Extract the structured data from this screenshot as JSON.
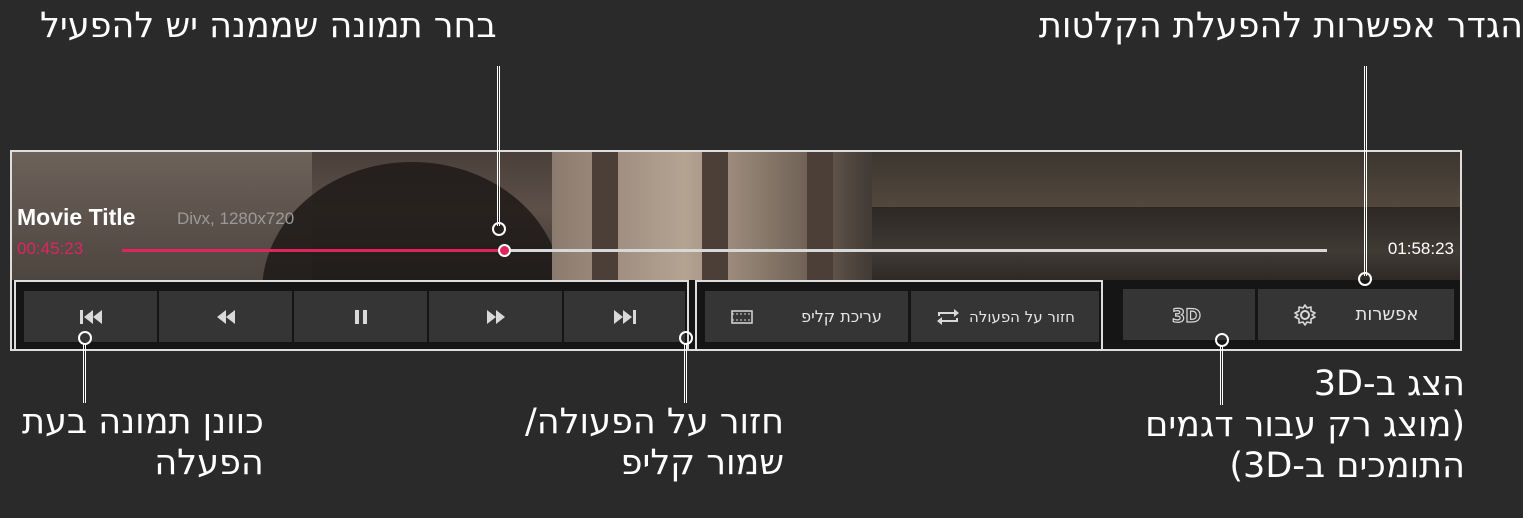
{
  "callouts": {
    "select_picture": "בחר תמונה שממנה יש להפעיל",
    "set_options": "הגדר אפשרות להפעלת הקלטות",
    "adjust_picture_line1": "כוונן תמונה בעת",
    "adjust_picture_line2": "הפעלה",
    "repeat_save_line1": "חזור על הפעולה/",
    "repeat_save_line2": "שמור קליפ",
    "view_3d_line1": "הצג ב-3D",
    "view_3d_line2": "(מוצג רק עבור דגמים",
    "view_3d_line3": "התומכים ב-3D)"
  },
  "player": {
    "title": "Movie Title",
    "meta": "Divx, 1280x720",
    "time_current": "00:45:23",
    "time_total": "01:58:23",
    "progress_fraction": 0.317
  },
  "controls": {
    "transport": [
      {
        "name": "skip-previous-button",
        "icon": "skip-previous-icon"
      },
      {
        "name": "rewind-button",
        "icon": "rewind-icon"
      },
      {
        "name": "pause-button",
        "icon": "pause-icon"
      },
      {
        "name": "fast-forward-button",
        "icon": "fast-forward-icon"
      },
      {
        "name": "skip-next-button",
        "icon": "skip-next-icon"
      }
    ],
    "edit_clip_label": "עריכת קליפ",
    "repeat_label": "חזור על הפעולה",
    "three_d_label": "3D",
    "options_label": "אפשרות"
  },
  "colors": {
    "accent": "#e0245e",
    "bar_background": "#151515",
    "button_background": "#353535"
  }
}
